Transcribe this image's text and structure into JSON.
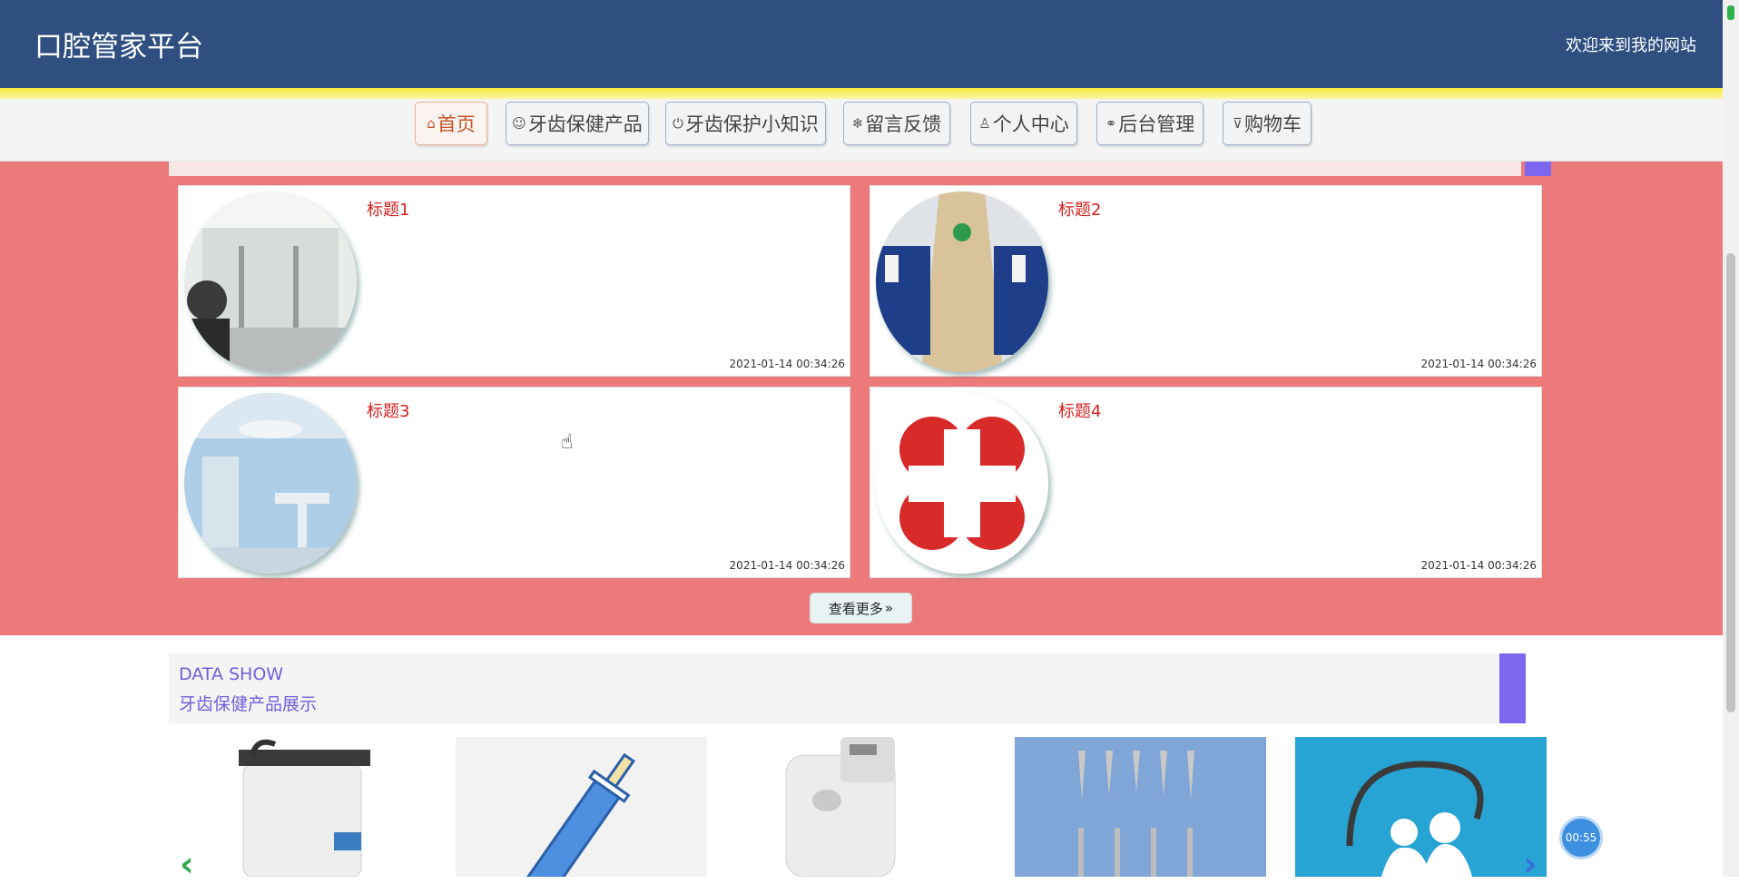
{
  "header": {
    "brand": "口腔管家平台",
    "welcome": "欢迎来到我的网站"
  },
  "nav": {
    "items": [
      {
        "label": "首页",
        "icon": "home-icon",
        "glyph": "⌂"
      },
      {
        "label": "牙齿保健产品",
        "icon": "smile-icon",
        "glyph": "☺"
      },
      {
        "label": "牙齿保护小知识",
        "icon": "power-icon",
        "glyph": "⏻"
      },
      {
        "label": "留言反馈",
        "icon": "snowflake-icon",
        "glyph": "❄"
      },
      {
        "label": "个人中心",
        "icon": "user-icon",
        "glyph": "♙"
      },
      {
        "label": "后台管理",
        "icon": "link-icon",
        "glyph": "⚭"
      },
      {
        "label": "购物车",
        "icon": "cart-icon",
        "glyph": "🛒"
      }
    ]
  },
  "news": {
    "cards": [
      {
        "title": "标题1",
        "time": "2021-01-14 00:34:26"
      },
      {
        "title": "标题2",
        "time": "2021-01-14 00:34:26"
      },
      {
        "title": "标题3",
        "time": "2021-01-14 00:34:26"
      },
      {
        "title": "标题4",
        "time": "2021-01-14 00:34:26"
      }
    ],
    "more_label": "查看更多",
    "more_icon": "double-chevron-right-icon"
  },
  "data_show": {
    "title_en": "DATA SHOW",
    "title_cn": "牙齿保健产品展示"
  },
  "timer": "00:55",
  "colors": {
    "header_bg": "#2e4f80",
    "news_bg": "#ec7a7a",
    "accent_purple": "#7b68ee",
    "title_red": "#d42020",
    "active_nav": "#c4562b"
  }
}
